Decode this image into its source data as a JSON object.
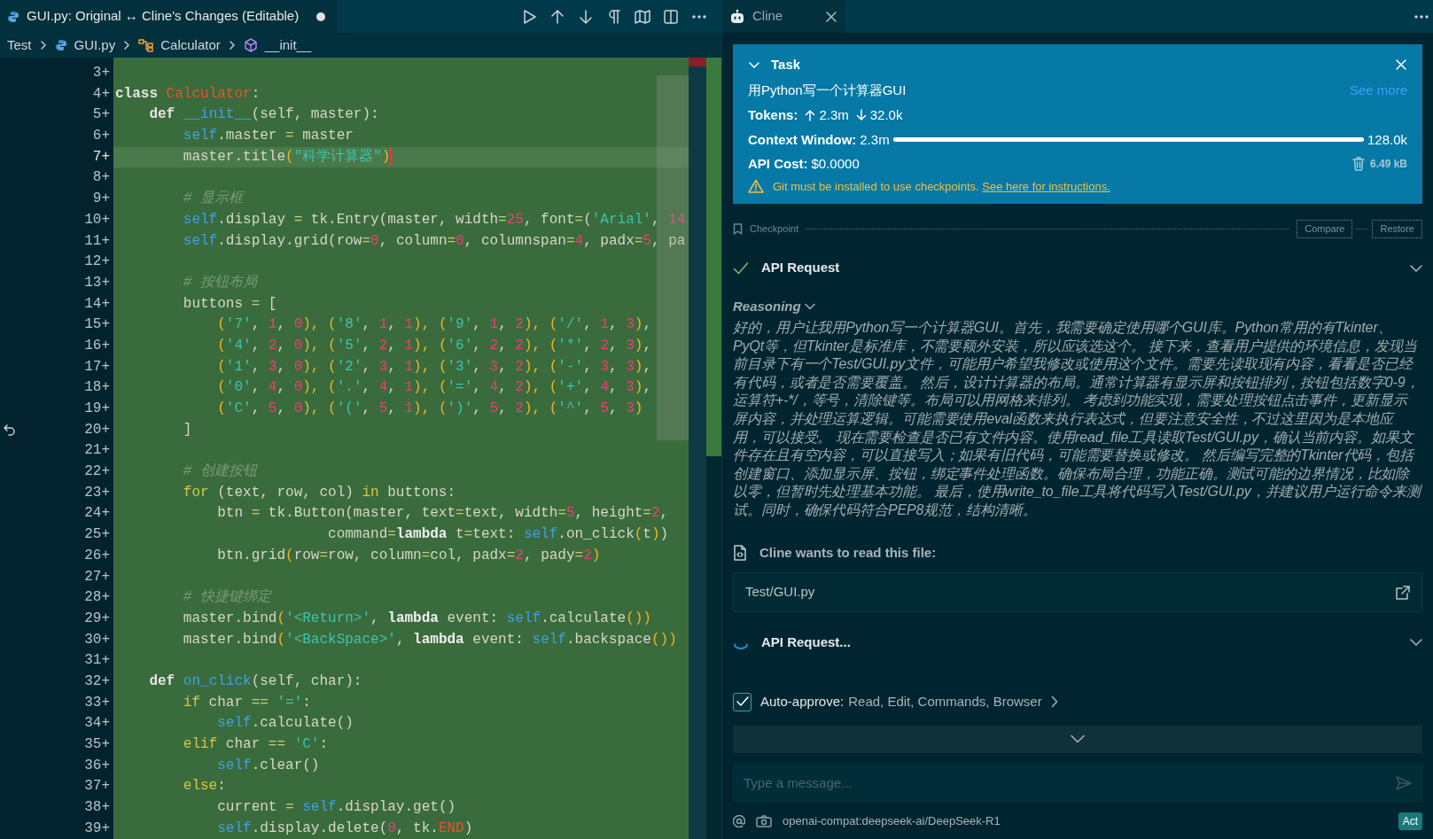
{
  "editor": {
    "tab": {
      "title": "GUI.py: Original ↔ Cline's Changes (Editable)",
      "dirty": true
    },
    "breadcrumbs": [
      {
        "label": "Test",
        "kind": "folder"
      },
      {
        "label": "GUI.py",
        "kind": "python"
      },
      {
        "label": "Calculator",
        "kind": "class"
      },
      {
        "label": "__init__",
        "kind": "method"
      }
    ],
    "lines": [
      {
        "n": "3+",
        "current": false
      },
      {
        "n": "4+",
        "current": false,
        "tokens": [
          {
            "text": "class",
            "kind": "kw"
          },
          {
            "text": " Calculator",
            "kind": "cls"
          },
          {
            "text": ":",
            "kind": "p"
          }
        ]
      },
      {
        "n": "5+",
        "current": false,
        "tokens": [
          {
            "text": "    def",
            "kind": "kw"
          },
          {
            "text": " __init__",
            "kind": "fn"
          },
          {
            "text": "(self, master):",
            "kind": "p"
          }
        ]
      },
      {
        "n": "6+",
        "current": false,
        "tokens": [
          {
            "text": "        self",
            "kind": "self"
          },
          {
            "text": ".master ",
            "kind": "p"
          },
          {
            "text": "=",
            "kind": "op"
          },
          {
            "text": " master",
            "kind": "p"
          }
        ]
      },
      {
        "n": "7+",
        "current": true,
        "tokens": [
          {
            "text": "        master.title",
            "kind": "p"
          },
          {
            "text": "(",
            "kind": "br"
          },
          {
            "text": "\"科学计算器\"",
            "kind": "str"
          },
          {
            "text": ")",
            "kind": "br"
          }
        ]
      },
      {
        "n": "8+",
        "current": false
      },
      {
        "n": "9+",
        "current": false,
        "tokens": [
          {
            "text": "        # 显示框",
            "kind": "com"
          }
        ]
      },
      {
        "n": "10+",
        "current": false,
        "tokens": [
          {
            "text": "        self",
            "kind": "self"
          },
          {
            "text": ".display ",
            "kind": "p"
          },
          {
            "text": "=",
            "kind": "op"
          },
          {
            "text": " tk.Entry(master, width",
            "kind": "p"
          },
          {
            "text": "=",
            "kind": "op"
          },
          {
            "text": "25",
            "kind": "num"
          },
          {
            "text": ", font",
            "kind": "p"
          },
          {
            "text": "=",
            "kind": "op"
          },
          {
            "text": "(",
            "kind": "p"
          },
          {
            "text": "'Arial'",
            "kind": "str"
          },
          {
            "text": ",",
            "kind": "p"
          },
          {
            "text": " 14",
            "kind": "num"
          }
        ]
      },
      {
        "n": "11+",
        "current": false,
        "tokens": [
          {
            "text": "        self",
            "kind": "self"
          },
          {
            "text": ".display.grid(row",
            "kind": "p"
          },
          {
            "text": "=",
            "kind": "op"
          },
          {
            "text": "0",
            "kind": "num"
          },
          {
            "text": ", column",
            "kind": "p"
          },
          {
            "text": "=",
            "kind": "op"
          },
          {
            "text": "0",
            "kind": "num"
          },
          {
            "text": ", columnspan",
            "kind": "p"
          },
          {
            "text": "=",
            "kind": "op"
          },
          {
            "text": "4",
            "kind": "num"
          },
          {
            "text": ", padx",
            "kind": "p"
          },
          {
            "text": "=",
            "kind": "op"
          },
          {
            "text": "5",
            "kind": "num"
          },
          {
            "text": ", pa",
            "kind": "p"
          }
        ]
      },
      {
        "n": "12+",
        "current": false
      },
      {
        "n": "13+",
        "current": false,
        "tokens": [
          {
            "text": "        # 按钮布局",
            "kind": "com"
          }
        ]
      },
      {
        "n": "14+",
        "current": false,
        "tokens": [
          {
            "text": "        buttons ",
            "kind": "p"
          },
          {
            "text": "=",
            "kind": "op"
          },
          {
            "text": " [",
            "kind": "p"
          }
        ]
      },
      {
        "n": "15+",
        "current": false,
        "tokens": [
          {
            "text": "            (",
            "kind": "br"
          },
          {
            "text": "'7'",
            "kind": "str"
          },
          {
            "text": ",",
            "kind": "p"
          },
          {
            "text": " 1",
            "kind": "num"
          },
          {
            "text": ",",
            "kind": "p"
          },
          {
            "text": " 0",
            "kind": "num"
          },
          {
            "text": "), (",
            "kind": "br"
          },
          {
            "text": "'8'",
            "kind": "str"
          },
          {
            "text": ",",
            "kind": "p"
          },
          {
            "text": " 1",
            "kind": "num"
          },
          {
            "text": ",",
            "kind": "p"
          },
          {
            "text": " 1",
            "kind": "num"
          },
          {
            "text": "), (",
            "kind": "br"
          },
          {
            "text": "'9'",
            "kind": "str"
          },
          {
            "text": ",",
            "kind": "p"
          },
          {
            "text": " 1",
            "kind": "num"
          },
          {
            "text": ",",
            "kind": "p"
          },
          {
            "text": " 2",
            "kind": "num"
          },
          {
            "text": "), (",
            "kind": "br"
          },
          {
            "text": "'/'",
            "kind": "str"
          },
          {
            "text": ",",
            "kind": "p"
          },
          {
            "text": " 1",
            "kind": "num"
          },
          {
            "text": ",",
            "kind": "p"
          },
          {
            "text": " 3",
            "kind": "num"
          },
          {
            "text": ")",
            "kind": "br"
          },
          {
            "text": ",",
            "kind": "p"
          }
        ]
      },
      {
        "n": "16+",
        "current": false,
        "tokens": [
          {
            "text": "            (",
            "kind": "br"
          },
          {
            "text": "'4'",
            "kind": "str"
          },
          {
            "text": ",",
            "kind": "p"
          },
          {
            "text": " 2",
            "kind": "num"
          },
          {
            "text": ",",
            "kind": "p"
          },
          {
            "text": " 0",
            "kind": "num"
          },
          {
            "text": "), (",
            "kind": "br"
          },
          {
            "text": "'5'",
            "kind": "str"
          },
          {
            "text": ",",
            "kind": "p"
          },
          {
            "text": " 2",
            "kind": "num"
          },
          {
            "text": ",",
            "kind": "p"
          },
          {
            "text": " 1",
            "kind": "num"
          },
          {
            "text": "), (",
            "kind": "br"
          },
          {
            "text": "'6'",
            "kind": "str"
          },
          {
            "text": ",",
            "kind": "p"
          },
          {
            "text": " 2",
            "kind": "num"
          },
          {
            "text": ",",
            "kind": "p"
          },
          {
            "text": " 2",
            "kind": "num"
          },
          {
            "text": "), (",
            "kind": "br"
          },
          {
            "text": "'*'",
            "kind": "str"
          },
          {
            "text": ",",
            "kind": "p"
          },
          {
            "text": " 2",
            "kind": "num"
          },
          {
            "text": ",",
            "kind": "p"
          },
          {
            "text": " 3",
            "kind": "num"
          },
          {
            "text": ")",
            "kind": "br"
          },
          {
            "text": ",",
            "kind": "p"
          }
        ]
      },
      {
        "n": "17+",
        "current": false,
        "tokens": [
          {
            "text": "            (",
            "kind": "br"
          },
          {
            "text": "'1'",
            "kind": "str"
          },
          {
            "text": ",",
            "kind": "p"
          },
          {
            "text": " 3",
            "kind": "num"
          },
          {
            "text": ",",
            "kind": "p"
          },
          {
            "text": " 0",
            "kind": "num"
          },
          {
            "text": "), (",
            "kind": "br"
          },
          {
            "text": "'2'",
            "kind": "str"
          },
          {
            "text": ",",
            "kind": "p"
          },
          {
            "text": " 3",
            "kind": "num"
          },
          {
            "text": ",",
            "kind": "p"
          },
          {
            "text": " 1",
            "kind": "num"
          },
          {
            "text": "), (",
            "kind": "br"
          },
          {
            "text": "'3'",
            "kind": "str"
          },
          {
            "text": ",",
            "kind": "p"
          },
          {
            "text": " 3",
            "kind": "num"
          },
          {
            "text": ",",
            "kind": "p"
          },
          {
            "text": " 2",
            "kind": "num"
          },
          {
            "text": "), (",
            "kind": "br"
          },
          {
            "text": "'-'",
            "kind": "str"
          },
          {
            "text": ",",
            "kind": "p"
          },
          {
            "text": " 3",
            "kind": "num"
          },
          {
            "text": ",",
            "kind": "p"
          },
          {
            "text": " 3",
            "kind": "num"
          },
          {
            "text": ")",
            "kind": "br"
          },
          {
            "text": ",",
            "kind": "p"
          }
        ]
      },
      {
        "n": "18+",
        "current": false,
        "tokens": [
          {
            "text": "            (",
            "kind": "br"
          },
          {
            "text": "'0'",
            "kind": "str"
          },
          {
            "text": ",",
            "kind": "p"
          },
          {
            "text": " 4",
            "kind": "num"
          },
          {
            "text": ",",
            "kind": "p"
          },
          {
            "text": " 0",
            "kind": "num"
          },
          {
            "text": "), (",
            "kind": "br"
          },
          {
            "text": "'.'",
            "kind": "str"
          },
          {
            "text": ",",
            "kind": "p"
          },
          {
            "text": " 4",
            "kind": "num"
          },
          {
            "text": ",",
            "kind": "p"
          },
          {
            "text": " 1",
            "kind": "num"
          },
          {
            "text": "), (",
            "kind": "br"
          },
          {
            "text": "'='",
            "kind": "str"
          },
          {
            "text": ",",
            "kind": "p"
          },
          {
            "text": " 4",
            "kind": "num"
          },
          {
            "text": ",",
            "kind": "p"
          },
          {
            "text": " 2",
            "kind": "num"
          },
          {
            "text": "), (",
            "kind": "br"
          },
          {
            "text": "'+'",
            "kind": "str"
          },
          {
            "text": ",",
            "kind": "p"
          },
          {
            "text": " 4",
            "kind": "num"
          },
          {
            "text": ",",
            "kind": "p"
          },
          {
            "text": " 3",
            "kind": "num"
          },
          {
            "text": ")",
            "kind": "br"
          },
          {
            "text": ",",
            "kind": "p"
          }
        ]
      },
      {
        "n": "19+",
        "current": false,
        "tokens": [
          {
            "text": "            (",
            "kind": "br"
          },
          {
            "text": "'C'",
            "kind": "str"
          },
          {
            "text": ",",
            "kind": "p"
          },
          {
            "text": " 5",
            "kind": "num"
          },
          {
            "text": ",",
            "kind": "p"
          },
          {
            "text": " 0",
            "kind": "num"
          },
          {
            "text": "), (",
            "kind": "br"
          },
          {
            "text": "'('",
            "kind": "str"
          },
          {
            "text": ",",
            "kind": "p"
          },
          {
            "text": " 5",
            "kind": "num"
          },
          {
            "text": ",",
            "kind": "p"
          },
          {
            "text": " 1",
            "kind": "num"
          },
          {
            "text": "), (",
            "kind": "br"
          },
          {
            "text": "')'",
            "kind": "str"
          },
          {
            "text": ",",
            "kind": "p"
          },
          {
            "text": " 5",
            "kind": "num"
          },
          {
            "text": ",",
            "kind": "p"
          },
          {
            "text": " 2",
            "kind": "num"
          },
          {
            "text": "), (",
            "kind": "br"
          },
          {
            "text": "'^'",
            "kind": "str"
          },
          {
            "text": ",",
            "kind": "p"
          },
          {
            "text": " 5",
            "kind": "num"
          },
          {
            "text": ",",
            "kind": "p"
          },
          {
            "text": " 3",
            "kind": "num"
          },
          {
            "text": ")",
            "kind": "br"
          }
        ]
      },
      {
        "n": "20+",
        "current": false,
        "tokens": [
          {
            "text": "        ]",
            "kind": "p"
          }
        ]
      },
      {
        "n": "21+",
        "current": false
      },
      {
        "n": "22+",
        "current": false,
        "tokens": [
          {
            "text": "        # 创建按钮",
            "kind": "com"
          }
        ]
      },
      {
        "n": "23+",
        "current": false,
        "tokens": [
          {
            "text": "        for",
            "kind": "ctl"
          },
          {
            "text": " (text, row, col) ",
            "kind": "p"
          },
          {
            "text": "in",
            "kind": "ctl"
          },
          {
            "text": " buttons:",
            "kind": "p"
          }
        ]
      },
      {
        "n": "24+",
        "current": false,
        "tokens": [
          {
            "text": "            btn ",
            "kind": "p"
          },
          {
            "text": "=",
            "kind": "op"
          },
          {
            "text": " tk.Button(master, text",
            "kind": "p"
          },
          {
            "text": "=",
            "kind": "op"
          },
          {
            "text": "text, width",
            "kind": "p"
          },
          {
            "text": "=",
            "kind": "op"
          },
          {
            "text": "5",
            "kind": "num"
          },
          {
            "text": ", height",
            "kind": "p"
          },
          {
            "text": "=",
            "kind": "op"
          },
          {
            "text": "2",
            "kind": "num"
          },
          {
            "text": ",",
            "kind": "p"
          }
        ]
      },
      {
        "n": "25+",
        "current": false,
        "tokens": [
          {
            "text": "                         command",
            "kind": "p"
          },
          {
            "text": "=",
            "kind": "op"
          },
          {
            "text": "lambda",
            "kind": "lam"
          },
          {
            "text": " t",
            "kind": "p"
          },
          {
            "text": "=",
            "kind": "op"
          },
          {
            "text": "text:",
            "kind": "p"
          },
          {
            "text": " self",
            "kind": "self"
          },
          {
            "text": ".on_click",
            "kind": "p"
          },
          {
            "text": "(",
            "kind": "br"
          },
          {
            "text": "t",
            "kind": "p"
          },
          {
            "text": ")",
            "kind": "br"
          },
          {
            "text": ")",
            "kind": "p"
          }
        ]
      },
      {
        "n": "26+",
        "current": false,
        "tokens": [
          {
            "text": "            btn.grid",
            "kind": "p"
          },
          {
            "text": "(",
            "kind": "br"
          },
          {
            "text": "row",
            "kind": "p"
          },
          {
            "text": "=",
            "kind": "op"
          },
          {
            "text": "row, column",
            "kind": "p"
          },
          {
            "text": "=",
            "kind": "op"
          },
          {
            "text": "col, padx",
            "kind": "p"
          },
          {
            "text": "=",
            "kind": "op"
          },
          {
            "text": "2",
            "kind": "num"
          },
          {
            "text": ", pady",
            "kind": "p"
          },
          {
            "text": "=",
            "kind": "op"
          },
          {
            "text": "2",
            "kind": "num"
          },
          {
            "text": ")",
            "kind": "br"
          }
        ]
      },
      {
        "n": "27+",
        "current": false
      },
      {
        "n": "28+",
        "current": false,
        "tokens": [
          {
            "text": "        # 快捷键绑定",
            "kind": "com"
          }
        ]
      },
      {
        "n": "29+",
        "current": false,
        "tokens": [
          {
            "text": "        master.bind",
            "kind": "p"
          },
          {
            "text": "(",
            "kind": "br"
          },
          {
            "text": "'<Return>'",
            "kind": "str"
          },
          {
            "text": ",",
            "kind": "p"
          },
          {
            "text": " lambda",
            "kind": "lam"
          },
          {
            "text": " event:",
            "kind": "p"
          },
          {
            "text": " self",
            "kind": "self"
          },
          {
            "text": ".calculate",
            "kind": "p"
          },
          {
            "text": "())",
            "kind": "br"
          }
        ]
      },
      {
        "n": "30+",
        "current": false,
        "tokens": [
          {
            "text": "        master.bind",
            "kind": "p"
          },
          {
            "text": "(",
            "kind": "br"
          },
          {
            "text": "'<BackSpace>'",
            "kind": "str"
          },
          {
            "text": ",",
            "kind": "p"
          },
          {
            "text": " lambda",
            "kind": "lam"
          },
          {
            "text": " event:",
            "kind": "p"
          },
          {
            "text": " self",
            "kind": "self"
          },
          {
            "text": ".backspace",
            "kind": "p"
          },
          {
            "text": "())",
            "kind": "br"
          }
        ]
      },
      {
        "n": "31+",
        "current": false
      },
      {
        "n": "32+",
        "current": false,
        "tokens": [
          {
            "text": "    def",
            "kind": "kw"
          },
          {
            "text": " on_click",
            "kind": "fn"
          },
          {
            "text": "(self, char):",
            "kind": "p"
          }
        ]
      },
      {
        "n": "33+",
        "current": false,
        "tokens": [
          {
            "text": "        if",
            "kind": "ctl"
          },
          {
            "text": " char ",
            "kind": "p"
          },
          {
            "text": "==",
            "kind": "op"
          },
          {
            "text": " '='",
            "kind": "str"
          },
          {
            "text": ":",
            "kind": "p"
          }
        ]
      },
      {
        "n": "34+",
        "current": false,
        "tokens": [
          {
            "text": "            self",
            "kind": "self"
          },
          {
            "text": ".calculate()",
            "kind": "p"
          }
        ]
      },
      {
        "n": "35+",
        "current": false,
        "tokens": [
          {
            "text": "        elif",
            "kind": "ctl"
          },
          {
            "text": " char ",
            "kind": "p"
          },
          {
            "text": "==",
            "kind": "op"
          },
          {
            "text": " 'C'",
            "kind": "str"
          },
          {
            "text": ":",
            "kind": "p"
          }
        ]
      },
      {
        "n": "36+",
        "current": false,
        "tokens": [
          {
            "text": "            self",
            "kind": "self"
          },
          {
            "text": ".clear()",
            "kind": "p"
          }
        ]
      },
      {
        "n": "37+",
        "current": false,
        "tokens": [
          {
            "text": "        else",
            "kind": "ctl"
          },
          {
            "text": ":",
            "kind": "p"
          }
        ]
      },
      {
        "n": "38+",
        "current": false,
        "tokens": [
          {
            "text": "            current ",
            "kind": "p"
          },
          {
            "text": "=",
            "kind": "op"
          },
          {
            "text": " self",
            "kind": "self"
          },
          {
            "text": ".display.get()",
            "kind": "p"
          }
        ]
      },
      {
        "n": "39+",
        "current": false,
        "tokens": [
          {
            "text": "            self",
            "kind": "self"
          },
          {
            "text": ".display.delete(",
            "kind": "p"
          },
          {
            "text": "0",
            "kind": "num"
          },
          {
            "text": ", tk.",
            "kind": "p"
          },
          {
            "text": "END",
            "kind": "cls"
          },
          {
            "text": ")",
            "kind": "p"
          }
        ]
      }
    ]
  },
  "cline": {
    "tab": {
      "title": "Cline"
    },
    "task": {
      "expanded": true,
      "heading": "Task",
      "text": "用Python写一个计算器GUI",
      "see_more": "See more",
      "tokens_label": "Tokens:",
      "tokens_in": "2.3m",
      "tokens_out": "32.0k",
      "context_label": "Context Window:",
      "context_used": "2.3m",
      "context_meter": {
        "level": 1
      },
      "context_max": "128.0k",
      "cost_label": "API Cost:",
      "cost": "$0.0000",
      "size": "6.49 kB",
      "warning": "Git must be installed to use checkpoints.",
      "warning_link": "See here for instructions."
    },
    "checkpoint": {
      "label": "Checkpoint",
      "buttons": [
        "Compare",
        "Restore"
      ]
    },
    "messages": [
      {
        "kind": "request",
        "done": true,
        "title": "API Request"
      },
      {
        "kind": "reasoning",
        "title": "Reasoning",
        "text": "好的，用户让我用Python写一个计算器GUI。首先，我需要确定使用哪个GUI库。Python常用的有Tkinter、PyQt等，但Tkinter是标准库，不需要额外安装，所以应该选这个。 接下来，查看用户提供的环境信息，发现当前目录下有一个Test/GUI.py文件，可能用户希望我修改或使用这个文件。需要先读取现有内容，看看是否已经有代码，或者是否需要覆盖。 然后，设计计算器的布局。通常计算器有显示屏和按钮排列，按钮包括数字0-9，运算符+-*/，等号，清除键等。布局可以用网格来排列。 考虑到功能实现，需要处理按钮点击事件，更新显示屏内容，并处理运算逻辑。可能需要使用eval函数来执行表达式，但要注意安全性，不过这里因为是本地应用，可以接受。 现在需要检查是否已有文件内容。使用read_file工具读取Test/GUI.py，确认当前内容。如果文件存在且有空内容，可以直接写入；如果有旧代码，可能需要替换或修改。 然后编写完整的Tkinter代码，包括创建窗口、添加显示屏、按钮，绑定事件处理函数。确保布局合理，功能正确。测试可能的边界情况，比如除以零，但暂时先处理基本功能。 最后，使用write_to_file工具将代码写入Test/GUI.py，并建议用户运行命令来测试。同时，确保代码符合PEP8规范，结构清晰。"
      },
      {
        "kind": "read_file",
        "title": "Cline wants to read this file:",
        "path": "Test/GUI.py"
      },
      {
        "kind": "request",
        "done": false,
        "title": "API Request..."
      }
    ],
    "auto_approve": {
      "checked": true,
      "label": "Auto-approve:",
      "value": "Read, Edit, Commands, Browser"
    },
    "input": {
      "placeholder": "Type a message..."
    },
    "footer": {
      "model": "openai-compat:deepseek-ai/DeepSeek-R1",
      "mode": "Act"
    }
  }
}
